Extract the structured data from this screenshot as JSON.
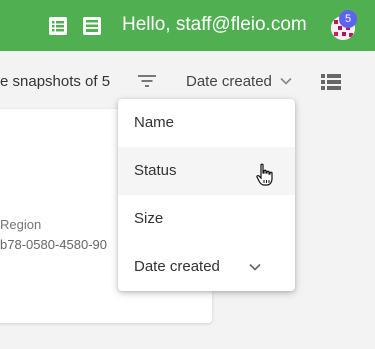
{
  "header": {
    "greeting": "Hello, staff@fleio.com",
    "notification_count": "5",
    "icons": [
      "list-alt-icon",
      "message-icon"
    ],
    "accent_color": "#50b051"
  },
  "toolbar": {
    "snapshots_text": "e snapshots of 5",
    "sort_label": "Date created",
    "icons": [
      "filter-icon",
      "chevron-down-icon",
      "list-view-icon"
    ]
  },
  "card": {
    "region_label": "Region",
    "region_value": "b78-0580-4580-90"
  },
  "sort_menu": {
    "items": [
      {
        "label": "Name"
      },
      {
        "label": "Status"
      },
      {
        "label": "Size"
      },
      {
        "label": "Date created"
      }
    ],
    "hovered": "Status"
  }
}
